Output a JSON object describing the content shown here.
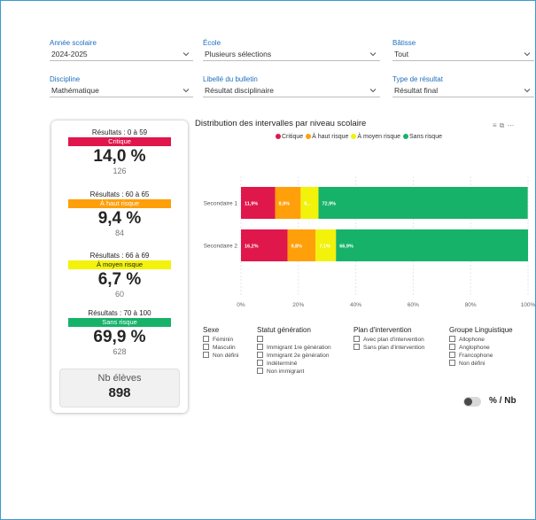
{
  "filters": [
    {
      "key": "annee",
      "label": "Année scolaire",
      "value": "2024-2025"
    },
    {
      "key": "ecole",
      "label": "École",
      "value": "Plusieurs sélections"
    },
    {
      "key": "batisse",
      "label": "Bâtisse",
      "value": "Tout"
    },
    {
      "key": "discipline",
      "label": "Discipline",
      "value": "Mathématique"
    },
    {
      "key": "libelle",
      "label": "Libellé du bulletin",
      "value": "Résultat disciplinaire"
    },
    {
      "key": "type",
      "label": "Type de résultat",
      "value": "Résultat final"
    }
  ],
  "kpis": [
    {
      "label": "Résultats : 0 à 59",
      "band": "Critique",
      "band_color": "#e0174b",
      "band_text_color": "#ffffff",
      "percent": "14,0 %",
      "count": "126"
    },
    {
      "label": "Résultats : 60 à 65",
      "band": "À haut risque",
      "band_color": "#ff9f0a",
      "band_text_color": "#ffffff",
      "percent": "9,4 %",
      "count": "84"
    },
    {
      "label": "Résultats : 66 à 69",
      "band": "À moyen risque",
      "band_color": "#f2f20a",
      "band_text_color": "#252423",
      "percent": "6,7 %",
      "count": "60"
    },
    {
      "label": "Résultats : 70 à 100",
      "band": "Sans risque",
      "band_color": "#17b26a",
      "band_text_color": "#ffffff",
      "percent": "69,9 %",
      "count": "628"
    }
  ],
  "nb_eleves": {
    "label": "Nb élèves",
    "value": "898"
  },
  "chart": {
    "title": "Distribution des intervalles par niveau scolaire",
    "icons": [
      "filter-icon",
      "focus-mode-icon",
      "more-options-icon"
    ]
  },
  "chart_data": {
    "type": "bar",
    "orientation": "horizontal",
    "stacked": true,
    "categories": [
      "Secondaire 1",
      "Secondaire 2"
    ],
    "series": [
      {
        "name": "Critique",
        "color": "#e0174b",
        "values": [
          11.9,
          16.2
        ],
        "labels": [
          "11,9%",
          "16,2%"
        ]
      },
      {
        "name": "À haut risque",
        "color": "#ff9f0a",
        "values": [
          8.9,
          9.8
        ],
        "labels": [
          "8,9%",
          "9,8%"
        ]
      },
      {
        "name": "À moyen risque",
        "color": "#f2f20a",
        "values": [
          6.2,
          7.1
        ],
        "labels": [
          "6...",
          "7,1%"
        ]
      },
      {
        "name": "Sans risque",
        "color": "#17b26a",
        "values": [
          72.9,
          66.9
        ],
        "labels": [
          "72,9%",
          "66,9%"
        ]
      }
    ],
    "xlim": [
      0,
      100
    ],
    "xticks": [
      "0%",
      "20%",
      "40%",
      "60%",
      "80%",
      "100%"
    ],
    "legend": "top",
    "grid": true
  },
  "slicers": [
    {
      "key": "sexe",
      "title": "Sexe",
      "options": [
        "Féminin",
        "Masculin",
        "Non défini"
      ]
    },
    {
      "key": "statut",
      "title": "Statut génération",
      "options": [
        "",
        "Immigrant 1re génération",
        "Immigrant 2e génération",
        "Indéterminé",
        "Non immigrant"
      ]
    },
    {
      "key": "plan",
      "title": "Plan d'intervention",
      "options": [
        "Avec plan d'intervention",
        "Sans plan d'intervention"
      ]
    },
    {
      "key": "groupe",
      "title": "Groupe Linguistique",
      "options": [
        "Allophone",
        "Anglophone",
        "Francophone",
        "Non défini"
      ]
    }
  ],
  "toggle": {
    "label": "% / Nb"
  }
}
